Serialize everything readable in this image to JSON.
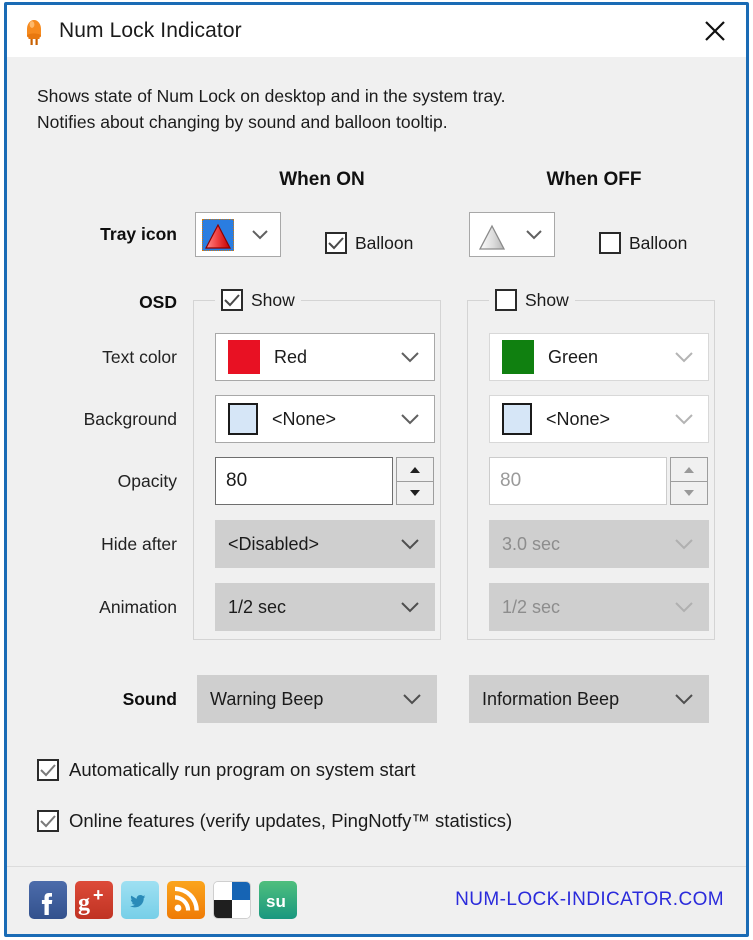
{
  "window": {
    "title": "Num Lock Indicator",
    "icon": "led-bulb-icon",
    "close_label": "✕",
    "border_color": "#1a6bb5"
  },
  "description": {
    "line1": "Shows state of Num Lock on desktop and in the system tray.",
    "line2": "Notifies about changing by sound and balloon tooltip."
  },
  "columns": {
    "on_header": "When ON",
    "off_header": "When OFF"
  },
  "labels": {
    "tray_icon": "Tray icon",
    "osd": "OSD",
    "text_color": "Text color",
    "background": "Background",
    "opacity": "Opacity",
    "hide_after": "Hide after",
    "animation": "Animation",
    "sound": "Sound"
  },
  "tray": {
    "on_icon": "red-triangle-icon",
    "off_icon": "grey-triangle-icon",
    "balloon_label_on": "Balloon",
    "balloon_label_off": "Balloon",
    "balloon_on_checked": true,
    "balloon_off_checked": false
  },
  "osd": {
    "show_label_on": "Show",
    "show_label_off": "Show",
    "show_on_checked": true,
    "show_off_checked": false,
    "on": {
      "text_color": "Red",
      "text_color_hex": "#e81123",
      "background": "<None>",
      "background_hex": "#d6e6f7",
      "opacity": "80",
      "hide_after": "<Disabled>",
      "animation": "1/2 sec"
    },
    "off": {
      "text_color": "Green",
      "text_color_hex": "#108010",
      "background": "<None>",
      "background_hex": "#d6e6f7",
      "opacity": "80",
      "hide_after": "3.0 sec",
      "animation": "1/2 sec"
    }
  },
  "sound": {
    "on": "Warning Beep",
    "off": "Information Beep"
  },
  "options": [
    {
      "label": "Automatically run program on system start",
      "checked": true
    },
    {
      "label": "Online features (verify updates, PingNotfy™ statistics)",
      "checked": true
    }
  ],
  "footer": {
    "url": "NUM-LOCK-INDICATOR.COM",
    "url_color": "#2b2bdb",
    "social": [
      {
        "name": "facebook-icon",
        "glyph": "f",
        "color": "#3b5998"
      },
      {
        "name": "google-plus-icon",
        "glyph": "g+",
        "color": "#d34836"
      },
      {
        "name": "twitter-icon",
        "glyph": "t",
        "color": "#7fd3ed"
      },
      {
        "name": "rss-icon",
        "glyph": "",
        "color": "#f7850a"
      },
      {
        "name": "delicious-icon",
        "glyph": "",
        "color": "#1f1f1f"
      },
      {
        "name": "stumbleupon-icon",
        "glyph": "su",
        "color": "#2aa06c"
      }
    ]
  }
}
